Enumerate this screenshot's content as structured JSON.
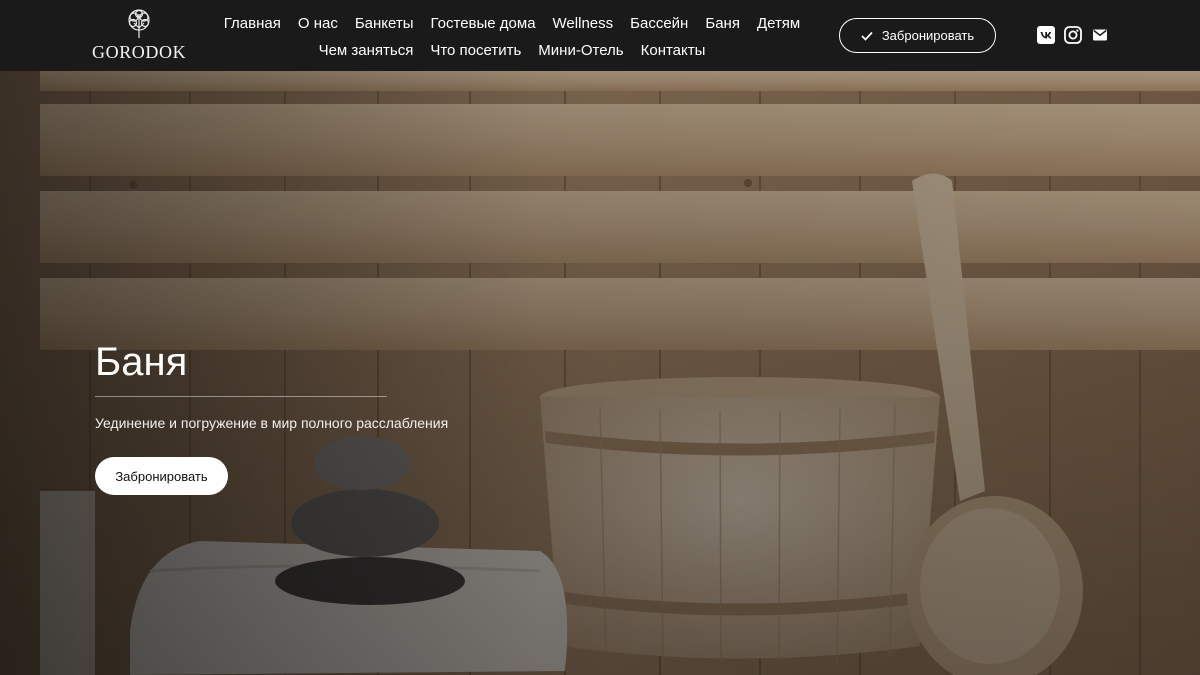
{
  "header": {
    "logo_text": "GORODOK",
    "nav_row1": [
      "Главная",
      "О нас",
      "Банкеты",
      "Гостевые дома",
      "Wellness",
      "Бассейн",
      "Баня",
      "Детям"
    ],
    "nav_row2": [
      "Чем заняться",
      "Что посетить",
      "Мини-Отель",
      "Контакты"
    ],
    "book_button": "Забронировать",
    "socials": [
      "vk-icon",
      "instagram-icon",
      "mail-icon"
    ]
  },
  "hero": {
    "title": "Баня",
    "subtitle": "Уединение и погружение в мир полного расслабления",
    "button": "Забронировать"
  },
  "colors": {
    "header_bg": "#1a1a1a",
    "text": "#ffffff",
    "wood": "#c8a883"
  }
}
